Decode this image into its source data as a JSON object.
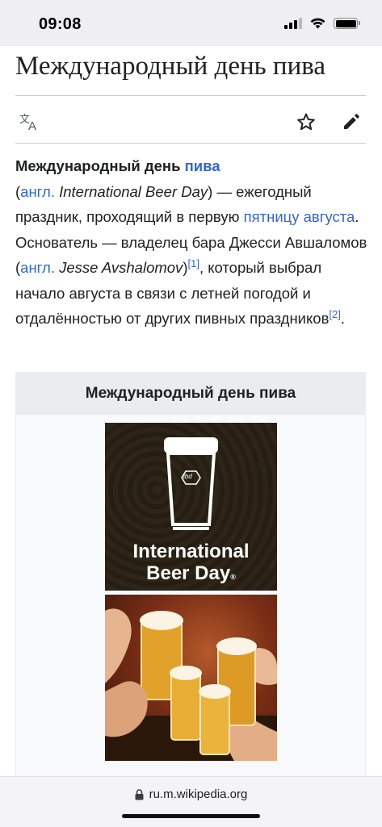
{
  "status": {
    "time": "09:08"
  },
  "article": {
    "title": "Международный день пива",
    "intro": {
      "t1": "Международный день ",
      "t2": "пива",
      "t3": "(",
      "t4": "англ.",
      "t5": " International Beer Day",
      "t6": ") — ежегодный праздник, проходящий в первую ",
      "t7": "пятницу августа",
      "t8": ". Основатель — владелец бара Джесси Авшаломов (",
      "t9": "англ.",
      "t10": " Jesse Avshalomov",
      "t11": ")",
      "ref1": "[1]",
      "t12": ", который выбрал начало августа в связи с летней погодой и отдалённостью от других пивных праздников",
      "ref2": "[2]",
      "t13": "."
    }
  },
  "toolbar": {
    "icons": [
      "translate-icon",
      "star-icon",
      "edit-icon"
    ]
  },
  "infobox": {
    "caption": "Международный день пива",
    "logo": {
      "badge": "ibd",
      "line1": "International",
      "line2": "Beer Day",
      "mark": "®"
    }
  },
  "browser": {
    "url": "ru.m.wikipedia.org"
  }
}
